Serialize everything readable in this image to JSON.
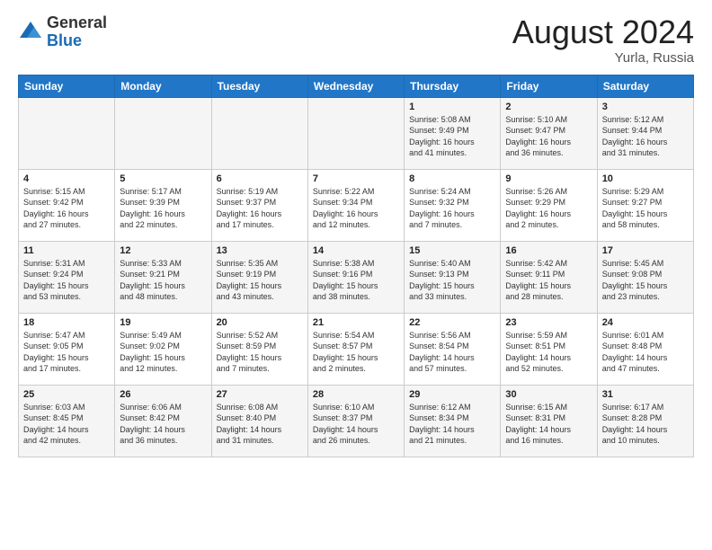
{
  "logo": {
    "general": "General",
    "blue": "Blue"
  },
  "header": {
    "month_year": "August 2024",
    "location": "Yurla, Russia"
  },
  "days_of_week": [
    "Sunday",
    "Monday",
    "Tuesday",
    "Wednesday",
    "Thursday",
    "Friday",
    "Saturday"
  ],
  "weeks": [
    [
      {
        "day": "",
        "info": ""
      },
      {
        "day": "",
        "info": ""
      },
      {
        "day": "",
        "info": ""
      },
      {
        "day": "",
        "info": ""
      },
      {
        "day": "1",
        "info": "Sunrise: 5:08 AM\nSunset: 9:49 PM\nDaylight: 16 hours\nand 41 minutes."
      },
      {
        "day": "2",
        "info": "Sunrise: 5:10 AM\nSunset: 9:47 PM\nDaylight: 16 hours\nand 36 minutes."
      },
      {
        "day": "3",
        "info": "Sunrise: 5:12 AM\nSunset: 9:44 PM\nDaylight: 16 hours\nand 31 minutes."
      }
    ],
    [
      {
        "day": "4",
        "info": "Sunrise: 5:15 AM\nSunset: 9:42 PM\nDaylight: 16 hours\nand 27 minutes."
      },
      {
        "day": "5",
        "info": "Sunrise: 5:17 AM\nSunset: 9:39 PM\nDaylight: 16 hours\nand 22 minutes."
      },
      {
        "day": "6",
        "info": "Sunrise: 5:19 AM\nSunset: 9:37 PM\nDaylight: 16 hours\nand 17 minutes."
      },
      {
        "day": "7",
        "info": "Sunrise: 5:22 AM\nSunset: 9:34 PM\nDaylight: 16 hours\nand 12 minutes."
      },
      {
        "day": "8",
        "info": "Sunrise: 5:24 AM\nSunset: 9:32 PM\nDaylight: 16 hours\nand 7 minutes."
      },
      {
        "day": "9",
        "info": "Sunrise: 5:26 AM\nSunset: 9:29 PM\nDaylight: 16 hours\nand 2 minutes."
      },
      {
        "day": "10",
        "info": "Sunrise: 5:29 AM\nSunset: 9:27 PM\nDaylight: 15 hours\nand 58 minutes."
      }
    ],
    [
      {
        "day": "11",
        "info": "Sunrise: 5:31 AM\nSunset: 9:24 PM\nDaylight: 15 hours\nand 53 minutes."
      },
      {
        "day": "12",
        "info": "Sunrise: 5:33 AM\nSunset: 9:21 PM\nDaylight: 15 hours\nand 48 minutes."
      },
      {
        "day": "13",
        "info": "Sunrise: 5:35 AM\nSunset: 9:19 PM\nDaylight: 15 hours\nand 43 minutes."
      },
      {
        "day": "14",
        "info": "Sunrise: 5:38 AM\nSunset: 9:16 PM\nDaylight: 15 hours\nand 38 minutes."
      },
      {
        "day": "15",
        "info": "Sunrise: 5:40 AM\nSunset: 9:13 PM\nDaylight: 15 hours\nand 33 minutes."
      },
      {
        "day": "16",
        "info": "Sunrise: 5:42 AM\nSunset: 9:11 PM\nDaylight: 15 hours\nand 28 minutes."
      },
      {
        "day": "17",
        "info": "Sunrise: 5:45 AM\nSunset: 9:08 PM\nDaylight: 15 hours\nand 23 minutes."
      }
    ],
    [
      {
        "day": "18",
        "info": "Sunrise: 5:47 AM\nSunset: 9:05 PM\nDaylight: 15 hours\nand 17 minutes."
      },
      {
        "day": "19",
        "info": "Sunrise: 5:49 AM\nSunset: 9:02 PM\nDaylight: 15 hours\nand 12 minutes."
      },
      {
        "day": "20",
        "info": "Sunrise: 5:52 AM\nSunset: 8:59 PM\nDaylight: 15 hours\nand 7 minutes."
      },
      {
        "day": "21",
        "info": "Sunrise: 5:54 AM\nSunset: 8:57 PM\nDaylight: 15 hours\nand 2 minutes."
      },
      {
        "day": "22",
        "info": "Sunrise: 5:56 AM\nSunset: 8:54 PM\nDaylight: 14 hours\nand 57 minutes."
      },
      {
        "day": "23",
        "info": "Sunrise: 5:59 AM\nSunset: 8:51 PM\nDaylight: 14 hours\nand 52 minutes."
      },
      {
        "day": "24",
        "info": "Sunrise: 6:01 AM\nSunset: 8:48 PM\nDaylight: 14 hours\nand 47 minutes."
      }
    ],
    [
      {
        "day": "25",
        "info": "Sunrise: 6:03 AM\nSunset: 8:45 PM\nDaylight: 14 hours\nand 42 minutes."
      },
      {
        "day": "26",
        "info": "Sunrise: 6:06 AM\nSunset: 8:42 PM\nDaylight: 14 hours\nand 36 minutes."
      },
      {
        "day": "27",
        "info": "Sunrise: 6:08 AM\nSunset: 8:40 PM\nDaylight: 14 hours\nand 31 minutes."
      },
      {
        "day": "28",
        "info": "Sunrise: 6:10 AM\nSunset: 8:37 PM\nDaylight: 14 hours\nand 26 minutes."
      },
      {
        "day": "29",
        "info": "Sunrise: 6:12 AM\nSunset: 8:34 PM\nDaylight: 14 hours\nand 21 minutes."
      },
      {
        "day": "30",
        "info": "Sunrise: 6:15 AM\nSunset: 8:31 PM\nDaylight: 14 hours\nand 16 minutes."
      },
      {
        "day": "31",
        "info": "Sunrise: 6:17 AM\nSunset: 8:28 PM\nDaylight: 14 hours\nand 10 minutes."
      }
    ]
  ]
}
